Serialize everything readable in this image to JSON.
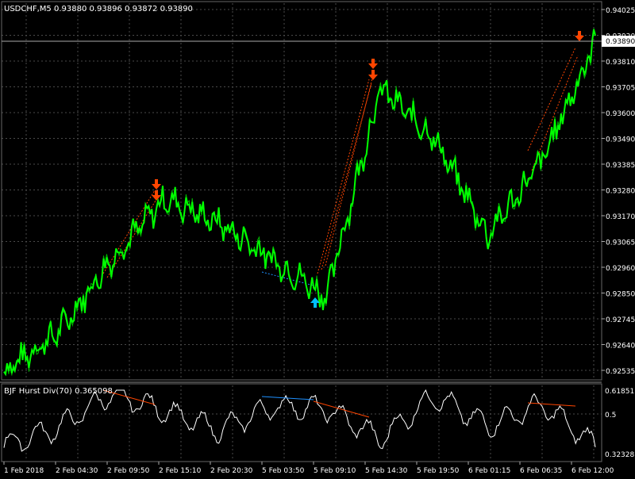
{
  "symbol_header": "USDCHF,M5  0.93880 0.93896 0.93872 0.93890",
  "price_axis": {
    "ticks": [
      "0.94025",
      "0.93920",
      "0.93810",
      "0.93705",
      "0.93600",
      "0.93490",
      "0.93385",
      "0.93280",
      "0.93170",
      "0.93065",
      "0.92960",
      "0.92850",
      "0.92745",
      "0.92640",
      "0.92535"
    ],
    "current_price": "0.93890"
  },
  "time_axis": [
    "1 Feb 2018",
    "2 Feb 04:30",
    "2 Feb 09:50",
    "2 Feb 15:10",
    "2 Feb 20:30",
    "5 Feb 03:50",
    "5 Feb 09:10",
    "5 Feb 14:30",
    "5 Feb 19:50",
    "6 Feb 01:15",
    "6 Feb 06:35",
    "6 Feb 12:00"
  ],
  "indicator": {
    "label": "BJF Hurst Div(70) 0.365098",
    "ticks": [
      "0.618511",
      "0.5",
      "0.323287"
    ]
  },
  "colors": {
    "background": "#000000",
    "grid": "#4a4a4a",
    "price_line": "#00ff00",
    "indicator_line": "#ffffff",
    "bearish_signal": "#ff4500",
    "bullish_signal": "#00bfff",
    "bearish_divergence": "#ff4500",
    "bullish_divergence": "#1e90ff"
  },
  "signals": [
    {
      "type": "sell",
      "icon": "arrow-down-icon",
      "time_index": 0,
      "count": 2
    },
    {
      "type": "buy",
      "icon": "arrow-up-icon",
      "time_index": 1,
      "count": 1
    },
    {
      "type": "sell",
      "icon": "arrow-down-icon",
      "time_index": 2,
      "count": 2
    },
    {
      "type": "sell",
      "icon": "arrow-down-icon",
      "time_index": 3,
      "count": 1
    }
  ],
  "chart_data": [
    {
      "type": "line",
      "title": "USDCHF,M5  0.93880 0.93896 0.93872 0.93890",
      "x": [
        "1 Feb 2018",
        "2 Feb 04:30",
        "2 Feb 09:50",
        "2 Feb 15:10",
        "2 Feb 20:30",
        "5 Feb 03:50",
        "5 Feb 09:10",
        "5 Feb 14:30",
        "5 Feb 19:50",
        "6 Feb 01:15",
        "6 Feb 06:35",
        "6 Feb 12:00"
      ],
      "series": [
        {
          "values": [
            0.9254,
            0.927,
            0.93,
            0.9325,
            0.9315,
            0.93,
            0.9285,
            0.937,
            0.935,
            0.931,
            0.934,
            0.9389
          ]
        }
      ],
      "ylim": [
        0.92535,
        0.94025
      ],
      "grid": true
    },
    {
      "type": "line",
      "title": "BJF Hurst Div(70) 0.365098",
      "x": [
        "1 Feb 2018",
        "2 Feb 04:30",
        "2 Feb 09:50",
        "2 Feb 15:10",
        "2 Feb 20:30",
        "5 Feb 03:50",
        "5 Feb 09:10",
        "5 Feb 14:30",
        "5 Feb 19:50",
        "6 Feb 01:15",
        "6 Feb 06:35",
        "6 Feb 12:00"
      ],
      "series": [
        {
          "values": [
            0.37,
            0.45,
            0.61,
            0.53,
            0.44,
            0.55,
            0.54,
            0.4,
            0.6,
            0.46,
            0.56,
            0.37
          ]
        }
      ],
      "ylim": [
        0.323287,
        0.618511
      ],
      "grid": true
    }
  ]
}
